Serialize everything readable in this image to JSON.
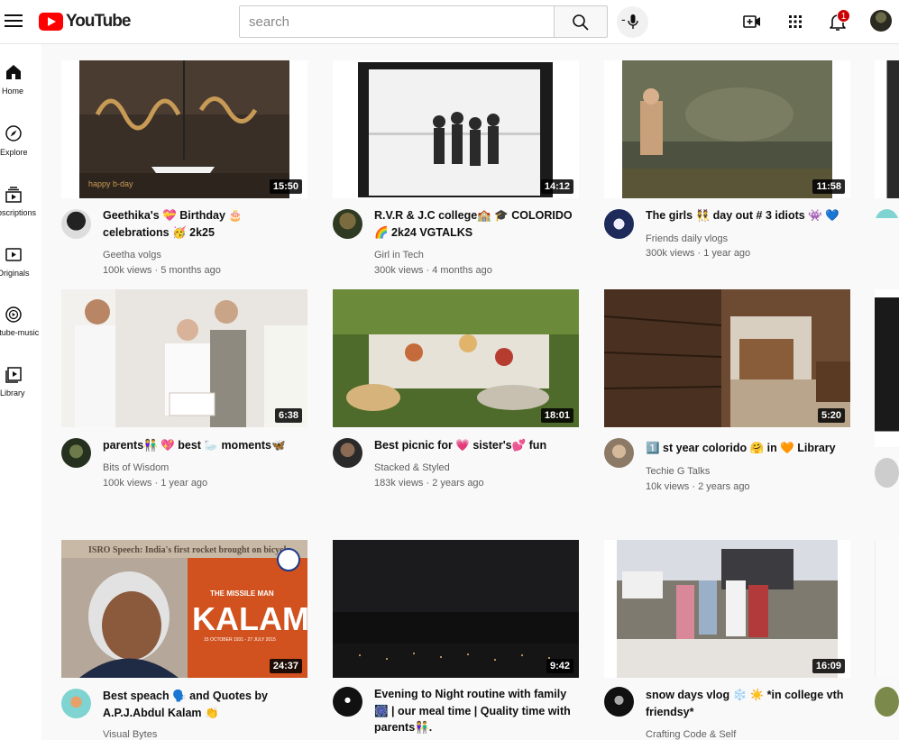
{
  "header": {
    "logo_text": "YouTube",
    "search_placeholder": "search",
    "mic_prefix": "-",
    "notification_count": "1"
  },
  "sidebar": {
    "items": [
      {
        "label": "Home",
        "icon": "home-icon"
      },
      {
        "label": "Explore",
        "icon": "compass-icon"
      },
      {
        "label": "Subscriptions",
        "icon": "subscriptions-icon"
      },
      {
        "label": "Originals",
        "icon": "originals-icon"
      },
      {
        "label": "Youtube-music",
        "icon": "music-icon"
      },
      {
        "label": "Library",
        "icon": "library-icon"
      }
    ]
  },
  "videos": [
    {
      "title": "Geethika's 💝 Birthday 🎂 celebrations 🥳 2k25",
      "channel": "Geetha volgs",
      "meta": "100k views · 5 months ago",
      "duration": "15:50"
    },
    {
      "title": "R.V.R & J.C college🏫 🎓 COLORIDO🌈 2k24 VGTALKS",
      "channel": "Girl in Tech",
      "meta": "300k views · 4 months ago",
      "duration": "14:12"
    },
    {
      "title": "The girls 👯 day out # 3 idiots 👾 💙",
      "channel": "Friends daily vlogs",
      "meta": "300k views · 1 year ago",
      "duration": "11:58"
    },
    {
      "title": "parents👫 💖 best 🦢 moments🦋",
      "channel": "Bits of Wisdom",
      "meta": "100k views · 1 year ago",
      "duration": "6:38"
    },
    {
      "title": "Best picnic for 💗 sister's💕 fun",
      "channel": "Stacked & Styled",
      "meta": "183k views · 2 years ago",
      "duration": "18:01"
    },
    {
      "title": "1️⃣ st year colorido 🤗 in 🧡 Library",
      "channel": "Techie G Talks",
      "meta": "10k views · 2 years ago",
      "duration": "5:20"
    },
    {
      "title": "Best speach 🗣️ and Quotes by A.P.J.Abdul Kalam 👏",
      "channel": "Visual Bytes",
      "meta": "",
      "duration": "24:37"
    },
    {
      "title": "Evening to Night routine with family🎆 | our meal time | Quality time with parents👫.",
      "channel": "",
      "meta": "",
      "duration": "9:42"
    },
    {
      "title": "snow days vlog ❄️ ☀️ *in college vth friendsy*",
      "channel": "Crafting Code & Self",
      "meta": "",
      "duration": "16:09"
    }
  ],
  "thumbnail_texts": {
    "kalam_header": "ISRO Speech: India's first rocket brought on bicycle",
    "kalam_tag": "THE MISSILE MAN",
    "kalam_name": "KALAM",
    "kalam_dates": "15 OCTOBER 1931 - 27 JULY 2015",
    "birthday_balloon": "happy b-day"
  }
}
